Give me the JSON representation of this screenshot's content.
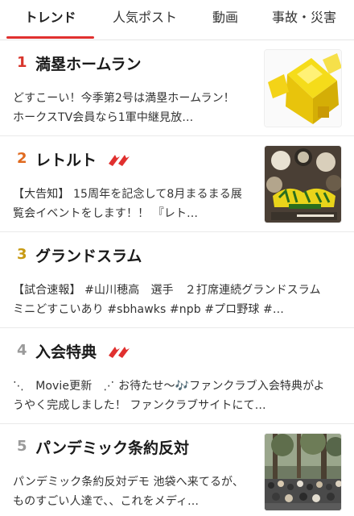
{
  "tabs": [
    {
      "label": "トレンド",
      "active": true
    },
    {
      "label": "人気ポスト",
      "active": false
    },
    {
      "label": "動画",
      "active": false
    },
    {
      "label": "事故・災害",
      "active": false
    }
  ],
  "colors": {
    "accent": "#e0302f",
    "rank1": "#d8352c",
    "rank2": "#e06a1f",
    "rank3": "#c79a12",
    "rankOther": "#9a9a9a"
  },
  "trends": [
    {
      "rank": "1",
      "title": "満塁ホームラン",
      "rising": false,
      "desc": "どすこーい！今季第2号は満塁ホームラン！ ホークスTV会員なら1軍中継見放…",
      "thumbnail": "yellow-block-image"
    },
    {
      "rank": "2",
      "title": "レトルト",
      "rising": true,
      "desc": "【大告知】 15周年を記念して8月まるまる展覧会イベントをします！！ 『レト…",
      "thumbnail": "anime-poster-image"
    },
    {
      "rank": "3",
      "title": "グランドスラム",
      "rising": false,
      "desc": "【試合速報】 #山川穂高　選手　２打席連続グランドスラム ミニどすこいあり #sbhawks #npb #プロ野球 #…",
      "thumbnail": ""
    },
    {
      "rank": "4",
      "title": "入会特典",
      "rising": true,
      "desc": "⋱　Movie更新　⋰ お待たせ〜🎶ファンクラブ入会特典がようやく完成しました！ ファンクラブサイトにて…",
      "thumbnail": ""
    },
    {
      "rank": "5",
      "title": "パンデミック条約反対",
      "rising": false,
      "desc": "パンデミック条約反対デモ 池袋へ来てるが、ものすごい人達で、、これをメディ…",
      "thumbnail": "crowd-photo-image"
    }
  ]
}
